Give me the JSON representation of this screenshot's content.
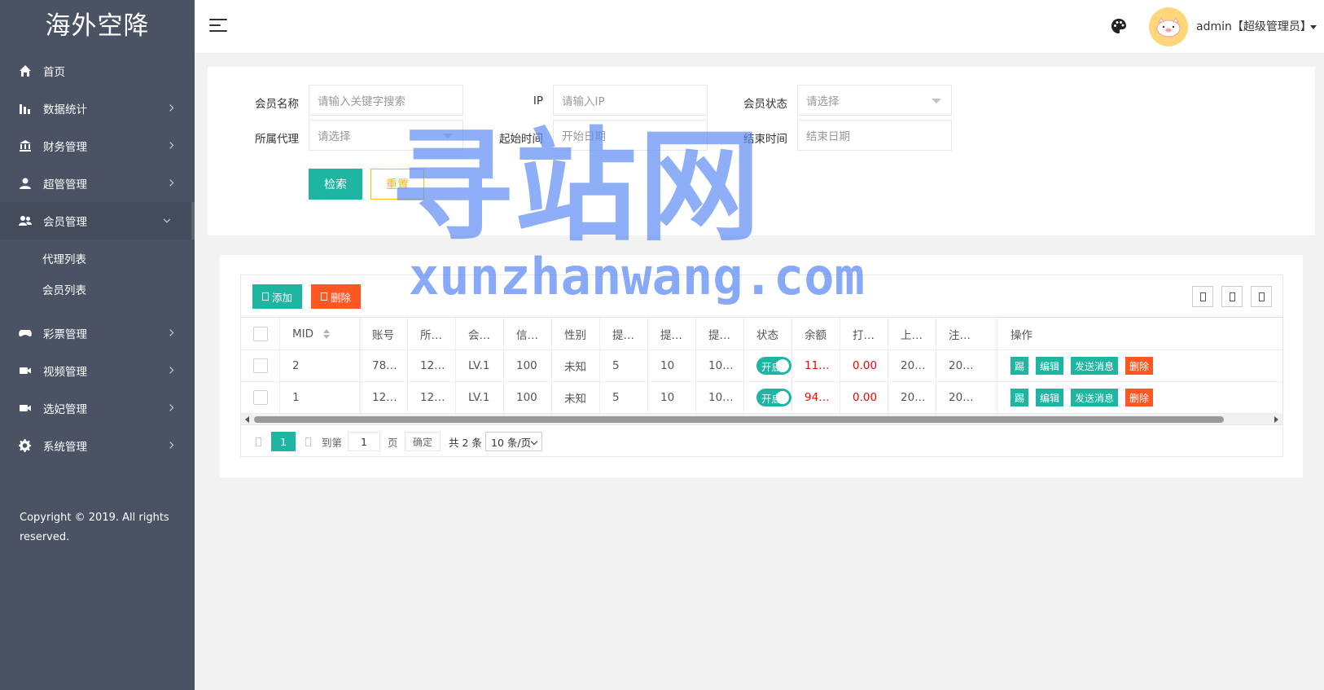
{
  "app": {
    "title": "海外空降",
    "copyright": "Copyright © 2019. All rights reserved."
  },
  "sidebar": {
    "items": [
      {
        "label": "首页",
        "icon": "home-icon",
        "arrow": false
      },
      {
        "label": "数据统计",
        "icon": "bar-chart-icon",
        "arrow": true
      },
      {
        "label": "财务管理",
        "icon": "bank-icon",
        "arrow": true
      },
      {
        "label": "超管管理",
        "icon": "user-icon",
        "arrow": true
      },
      {
        "label": "会员管理",
        "icon": "users-icon",
        "arrow": true,
        "open": true,
        "children": [
          "代理列表",
          "会员列表"
        ]
      },
      {
        "label": "彩票管理",
        "icon": "gamepad-icon",
        "arrow": true
      },
      {
        "label": "视频管理",
        "icon": "video-camera-icon",
        "arrow": true
      },
      {
        "label": "选妃管理",
        "icon": "video-camera-icon",
        "arrow": true
      },
      {
        "label": "系统管理",
        "icon": "gear-icon",
        "arrow": true
      }
    ]
  },
  "header": {
    "user": "admin【超级管理员】",
    "icons": [
      "menu-toggle-icon",
      "palette-icon",
      "pig-avatar-icon"
    ]
  },
  "search": {
    "member_name_label": "会员名称",
    "member_name_placeholder": "请输入关键字搜索",
    "ip_label": "IP",
    "ip_placeholder": "请输入IP",
    "status_label": "会员状态",
    "status_placeholder": "请选择",
    "agent_label": "所属代理",
    "agent_placeholder": "请选择",
    "start_label": "起始时间",
    "start_placeholder": "开始日期",
    "end_label": "结束时间",
    "end_placeholder": "结束日期",
    "search_button": "检索",
    "reset_button": "重置"
  },
  "toolbar": {
    "add": "添加",
    "delete": "删除"
  },
  "table": {
    "columns": [
      "MID",
      "账号",
      "所…",
      "会…",
      "信…",
      "性别",
      "提…",
      "提…",
      "提…",
      "状态",
      "余额",
      "打…",
      "上…",
      "注…",
      "操作"
    ],
    "rows": [
      {
        "mid": "2",
        "account": "78…",
        "agent": "12…",
        "level": "LV.1",
        "credit": "100",
        "gender": "未知",
        "w1": "5",
        "w2": "10",
        "w3": "10…",
        "status": "开启",
        "balance": "11…",
        "bet": "0.00",
        "last": "20…",
        "reg": "20…"
      },
      {
        "mid": "1",
        "account": "12…",
        "agent": "12…",
        "level": "LV.1",
        "credit": "100",
        "gender": "未知",
        "w1": "5",
        "w2": "10",
        "w3": "10…",
        "status": "开启",
        "balance": "94…",
        "bet": "0.00",
        "last": "20…",
        "reg": "20…"
      }
    ],
    "actions": [
      "踢",
      "编辑",
      "发送消息",
      "删除"
    ]
  },
  "pager": {
    "current": "1",
    "goto_label": "到第",
    "goto_value": "1",
    "page_unit": "页",
    "confirm": "确定",
    "total": "共 2 条",
    "per_page": "10 条/页"
  },
  "watermark": {
    "cn": "寻站网",
    "en": "xunzhanwang.com"
  },
  "colors": {
    "sidebar": "#4a5263",
    "primary": "#1fb5a3",
    "danger": "#ff5722",
    "warn": "#ffb800",
    "money": "#ff0000"
  }
}
